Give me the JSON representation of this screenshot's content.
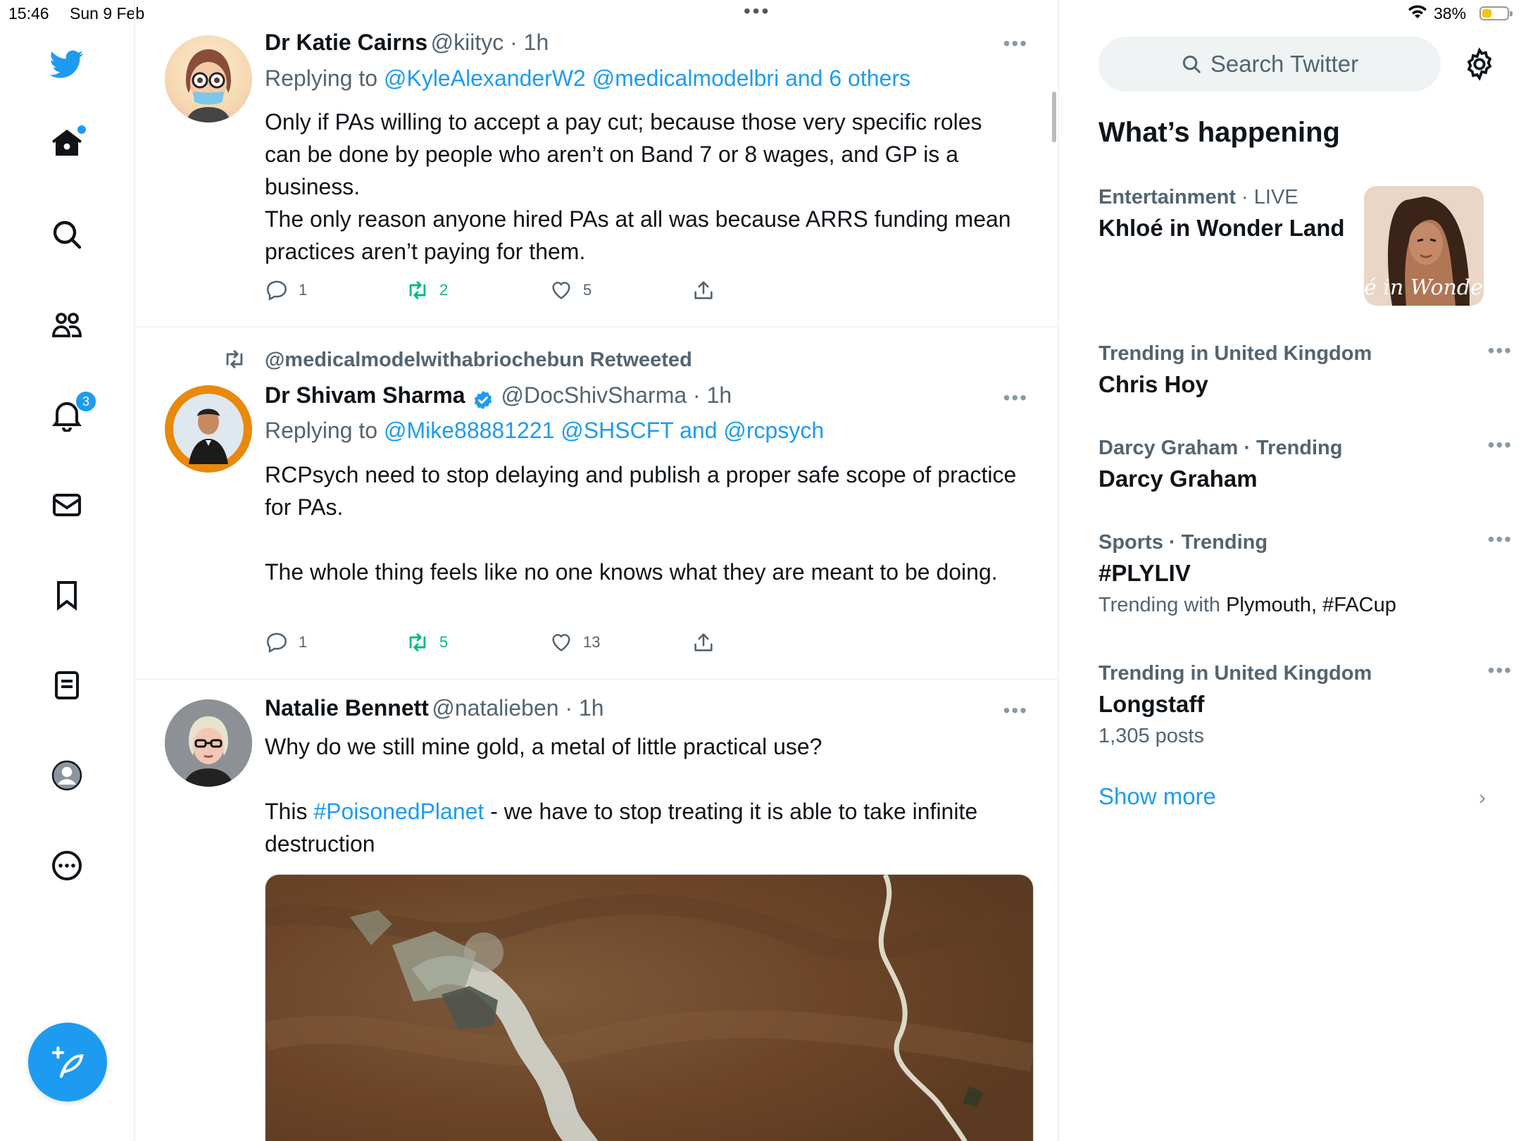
{
  "status_bar": {
    "time": "15:46",
    "date": "Sun 9 Feb",
    "battery": "38%",
    "battery_level": 0.38
  },
  "nav": {
    "notifications_badge": "3",
    "accent": "#1d9bf0",
    "icons": [
      "twitter-bird-icon",
      "home-icon",
      "search-icon",
      "communities-icon",
      "bell-icon",
      "mail-icon",
      "bookmark-icon",
      "lists-icon",
      "profile-icon",
      "more-icon",
      "compose-icon"
    ]
  },
  "tweets": [
    {
      "name": "Dr Katie Cairns",
      "handle": "@kiityc",
      "time": "1h",
      "replying_prefix": "Replying to ",
      "replying_to": "@KyleAlexanderW2 @medicalmodelbri and 6 others",
      "text_lines": [
        "Only if PAs willing to accept a pay cut; because those very specific roles can be done by people who aren’t on Band 7 or 8 wages, and GP is a business.",
        "The only reason anyone hired PAs at all was because ARRS funding mean practices aren’t paying for them."
      ],
      "replies": "1",
      "retweets": "2",
      "likes": "5"
    },
    {
      "retweeted_by": "@medicalmodelwithabriochebun Retweeted",
      "name": "Dr Shivam Sharma",
      "handle": "@DocShivSharma",
      "time": "1h",
      "replying_prefix": "Replying to ",
      "replying_to": "@Mike88881221 @SHSCFT and @rcpsych",
      "text_lines": [
        "RCPsych need to stop delaying and publish a proper safe scope of practice for PAs.",
        "The whole thing feels like no one knows what they are meant to be doing."
      ],
      "replies": "1",
      "retweets": "5",
      "likes": "13"
    },
    {
      "name": "Natalie Bennett",
      "handle": "@natalieben",
      "time": "1h",
      "text_line1": "Why do we still mine gold, a metal of little practical use?",
      "text_pre": "This ",
      "hashtag": "#PoisonedPlanet",
      "text_post": " - we have to stop treating it is able to take infinite destruction"
    }
  ],
  "sidebar": {
    "search_placeholder": "Search Twitter",
    "heading": "What’s happening",
    "trends": [
      {
        "category": "Entertainment",
        "live": "LIVE",
        "title": "Khloé in Wonder Land",
        "image_text": "é in Wonder L"
      },
      {
        "category": "Trending in United Kingdom",
        "title": "Chris Hoy"
      },
      {
        "category": "Darcy Graham · Trending",
        "title": "Darcy Graham"
      },
      {
        "category": "Sports · Trending",
        "title": "#PLYLIV",
        "trending_with_label": "Trending with ",
        "trending_with": "Plymouth, #FACup"
      },
      {
        "category": "Trending in United Kingdom",
        "title": "Longstaff",
        "posts": "1,305 posts"
      }
    ],
    "show_more": "Show more"
  }
}
